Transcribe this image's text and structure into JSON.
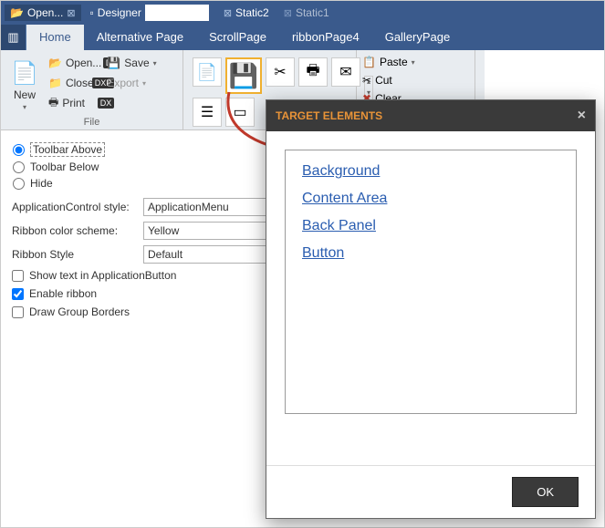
{
  "titlebar": {
    "tabs": [
      {
        "label": "Open...",
        "icon": "folder"
      },
      {
        "label": "Designer",
        "icon": "page"
      },
      {
        "label": "Static2",
        "icon": "x"
      },
      {
        "label": "Static1",
        "icon": "x"
      }
    ]
  },
  "ribbon": {
    "tabs": [
      "Home",
      "Alternative Page",
      "ScrollPage",
      "ribbonPage4",
      "GalleryPage"
    ],
    "active_tab": "Home",
    "new_label": "New",
    "file_actions": {
      "open": "Open...",
      "close": "Close",
      "print": "Print",
      "save": "Save",
      "export": "Export"
    },
    "group_file_label": "File",
    "key_hints": {
      "open": "D",
      "close": "DXP",
      "print": "DX"
    },
    "paste": {
      "paste": "Paste",
      "cut": "Cut",
      "clear": "Clear"
    }
  },
  "options": {
    "radios": {
      "above": "Toolbar Above",
      "below": "Toolbar Below",
      "hide": "Hide"
    },
    "selected": "above",
    "app_style_label": "ApplicationControl style:",
    "app_style_value": "ApplicationMenu",
    "color_label": "Ribbon color scheme:",
    "color_value": "Yellow",
    "ribbon_style_label": "Ribbon Style",
    "ribbon_style_value": "Default",
    "show_text": "Show text in ApplicationButton",
    "enable_ribbon": "Enable ribbon",
    "draw_borders": "Draw Group Borders"
  },
  "dialog": {
    "title": "TARGET ELEMENTS",
    "items": [
      "Background",
      "Content Area",
      "Back Panel",
      "Button"
    ],
    "ok": "OK"
  }
}
